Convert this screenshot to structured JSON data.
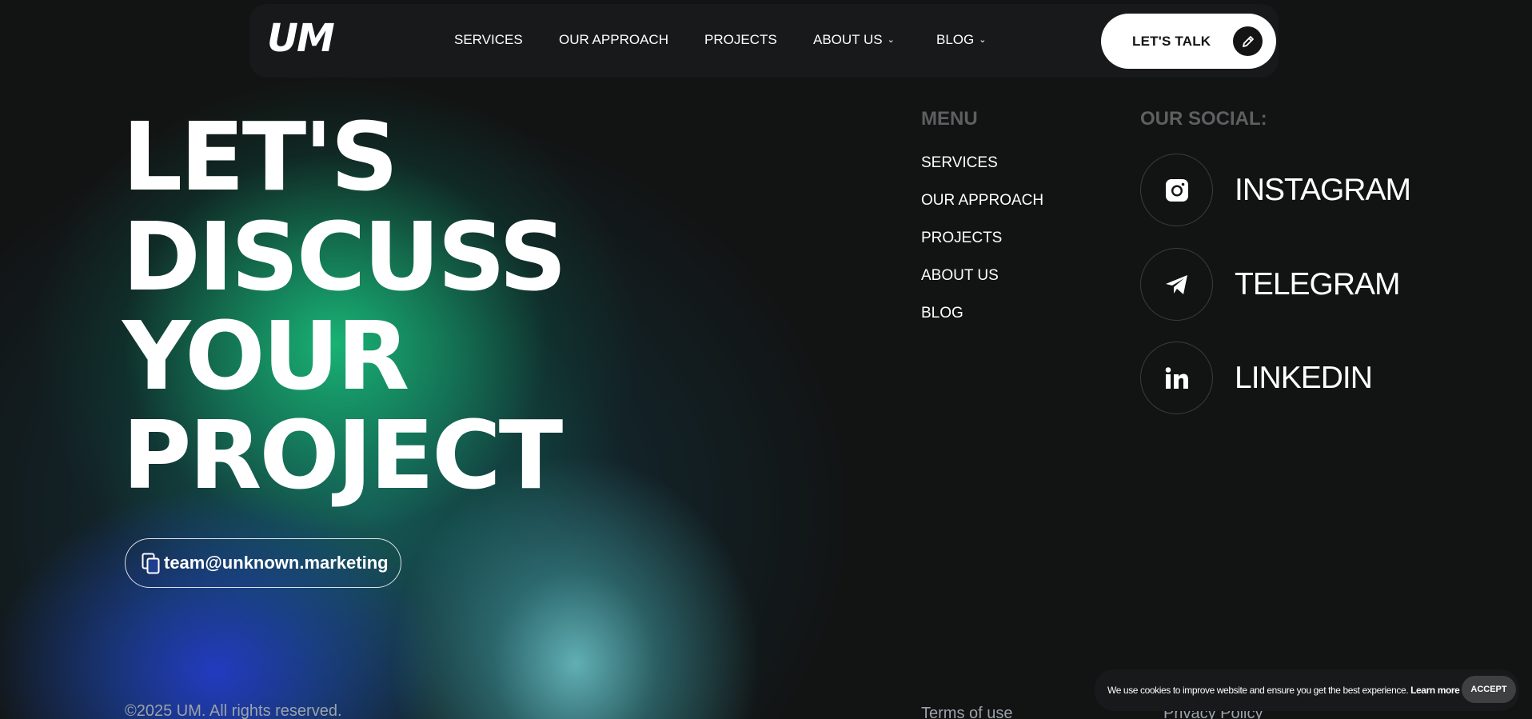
{
  "header": {
    "logo": "UM",
    "nav": [
      {
        "label": "SERVICES"
      },
      {
        "label": "OUR APPROACH"
      },
      {
        "label": "PROJECTS"
      },
      {
        "label": "ABOUT US",
        "dropdown": true
      },
      {
        "label": "BLOG",
        "dropdown": true
      }
    ],
    "cta": {
      "label": "LET'S TALK",
      "icon": "pencil-icon"
    }
  },
  "hero": {
    "lines": [
      "LET'S",
      "DISCUSS",
      "YOUR",
      "PROJECT"
    ],
    "email": "team@unknown.marketing",
    "email_icon": "copy-icon"
  },
  "menu": {
    "title": "MENU",
    "items": [
      "SERVICES",
      "OUR APPROACH",
      "PROJECTS",
      "ABOUT US",
      "BLOG"
    ]
  },
  "social": {
    "title": "OUR SOCIAL:",
    "items": [
      {
        "label": "INSTAGRAM",
        "icon": "instagram-icon"
      },
      {
        "label": "TELEGRAM",
        "icon": "telegram-icon"
      },
      {
        "label": "LINKEDIN",
        "icon": "linkedin-icon"
      }
    ]
  },
  "footer": {
    "copyright": "©2025 UM. All rights reserved.",
    "terms": "Terms of use",
    "privacy": "Privacy Policy"
  },
  "cookie": {
    "message": "We use cookies to improve website and ensure you get the best experience.",
    "learn_more": "Learn more",
    "accept": "ACCEPT"
  },
  "colors": {
    "background": "#121313",
    "nav_bar": "#17191a",
    "muted_title": "#5d5f60",
    "glow_green": "#19b978",
    "glow_blue": "#233cc8",
    "glow_teal": "#6ec8cd"
  }
}
